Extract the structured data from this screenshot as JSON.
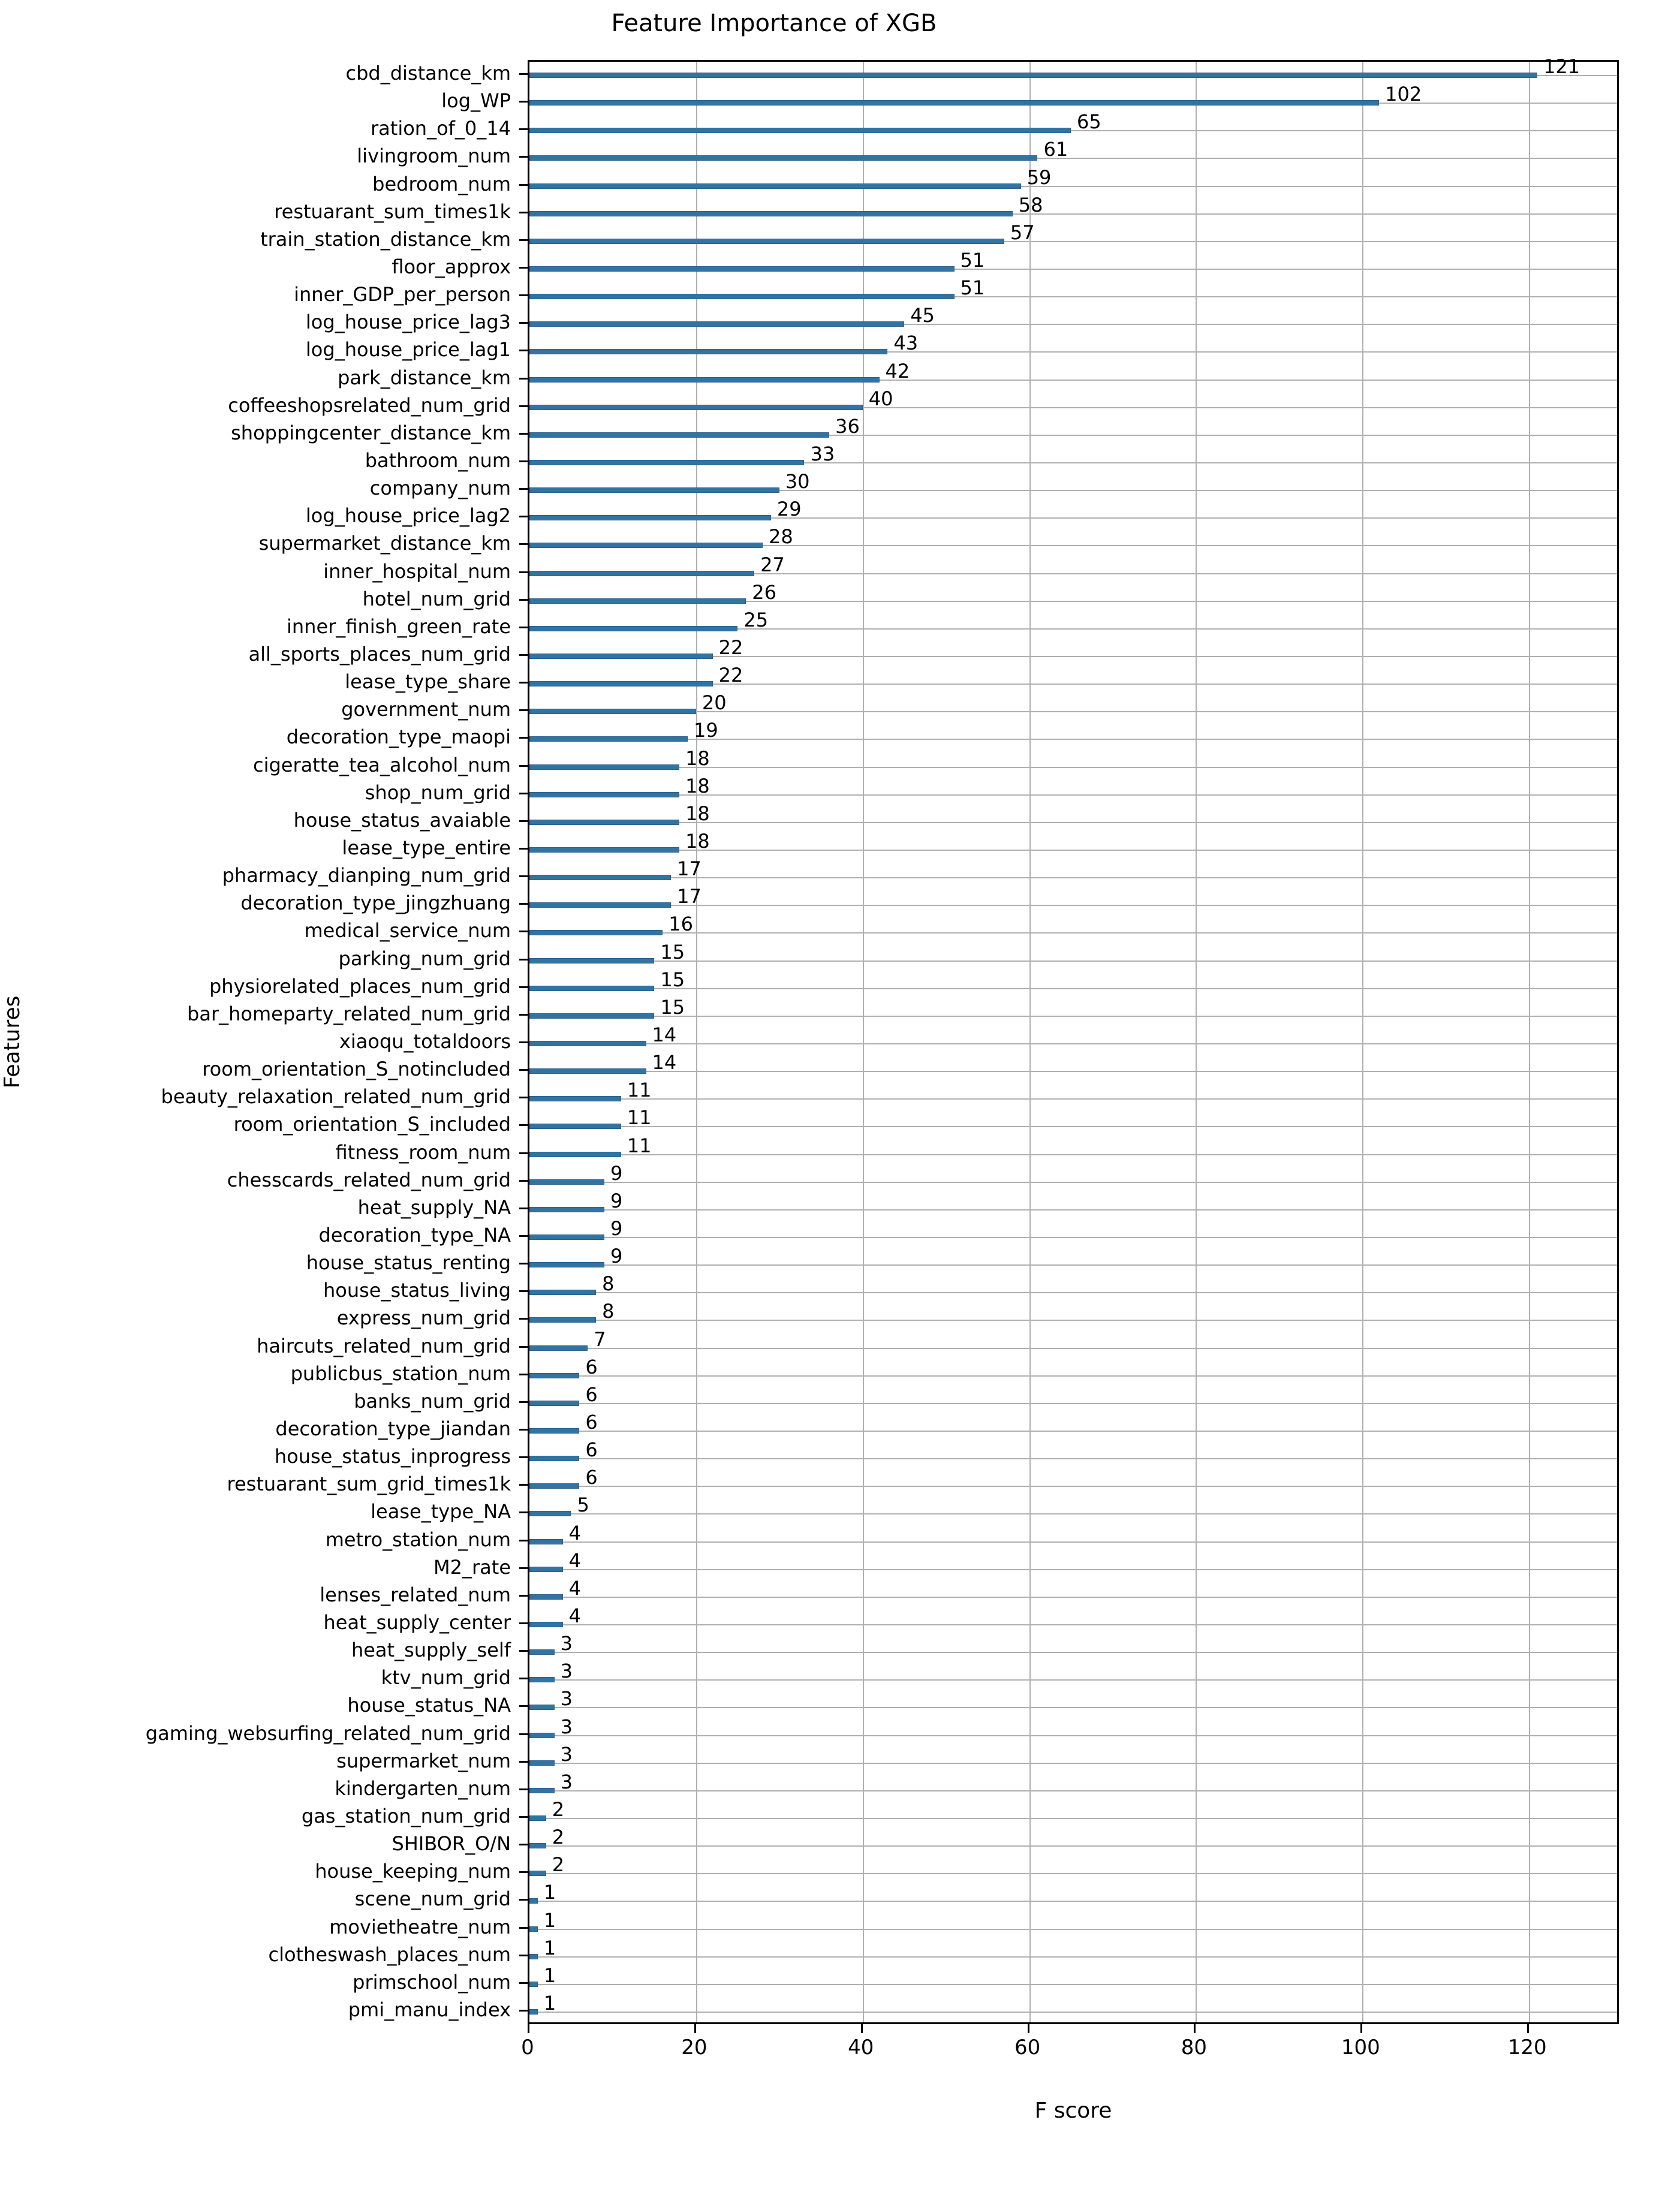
{
  "chart_data": {
    "type": "bar",
    "orientation": "horizontal",
    "title": "Feature Importance of XGB",
    "xlabel": "F score",
    "ylabel": "Features",
    "xlim": [
      0,
      131
    ],
    "xticks": [
      0,
      20,
      40,
      60,
      80,
      100,
      120
    ],
    "grid": true,
    "legend": null,
    "bar_color": "#3274a1",
    "grid_color": "#b0b0b0",
    "categories": [
      "cbd_distance_km",
      "log_WP",
      "ration_of_0_14",
      "livingroom_num",
      "bedroom_num",
      "restuarant_sum_times1k",
      "train_station_distance_km",
      "floor_approx",
      "inner_GDP_per_person",
      "log_house_price_lag3",
      "log_house_price_lag1",
      "park_distance_km",
      "coffeeshopsrelated_num_grid",
      "shoppingcenter_distance_km",
      "bathroom_num",
      "company_num",
      "log_house_price_lag2",
      "supermarket_distance_km",
      "inner_hospital_num",
      "hotel_num_grid",
      "inner_finish_green_rate",
      "all_sports_places_num_grid",
      "lease_type_share",
      "government_num",
      "decoration_type_maopi",
      "cigeratte_tea_alcohol_num",
      "shop_num_grid",
      "house_status_avaiable",
      "lease_type_entire",
      "pharmacy_dianping_num_grid",
      "decoration_type_jingzhuang",
      "medical_service_num",
      "parking_num_grid",
      "physiorelated_places_num_grid",
      "bar_homeparty_related_num_grid",
      "xiaoqu_totaldoors",
      "room_orientation_S_notincluded",
      "beauty_relaxation_related_num_grid",
      "room_orientation_S_included",
      "fitness_room_num",
      "chesscards_related_num_grid",
      "heat_supply_NA",
      "decoration_type_NA",
      "house_status_renting",
      "house_status_living",
      "express_num_grid",
      "haircuts_related_num_grid",
      "publicbus_station_num",
      "banks_num_grid",
      "decoration_type_jiandan",
      "house_status_inprogress",
      "restuarant_sum_grid_times1k",
      "lease_type_NA",
      "metro_station_num",
      "M2_rate",
      "lenses_related_num",
      "heat_supply_center",
      "heat_supply_self",
      "ktv_num_grid",
      "house_status_NA",
      "gaming_websurfing_related_num_grid",
      "supermarket_num",
      "kindergarten_num",
      "gas_station_num_grid",
      "SHIBOR_O/N",
      "house_keeping_num",
      "scene_num_grid",
      "movietheatre_num",
      "clotheswash_places_num",
      "primschool_num",
      "pmi_manu_index"
    ],
    "values": [
      121,
      102,
      65,
      61,
      59,
      58,
      57,
      51,
      51,
      45,
      43,
      42,
      40,
      36,
      33,
      30,
      29,
      28,
      27,
      26,
      25,
      22,
      22,
      20,
      19,
      18,
      18,
      18,
      18,
      17,
      17,
      16,
      15,
      15,
      15,
      14,
      14,
      11,
      11,
      11,
      9,
      9,
      9,
      9,
      8,
      8,
      7,
      6,
      6,
      6,
      6,
      6,
      5,
      4,
      4,
      4,
      4,
      3,
      3,
      3,
      3,
      3,
      3,
      2,
      2,
      2,
      1,
      1,
      1,
      1,
      1
    ]
  }
}
